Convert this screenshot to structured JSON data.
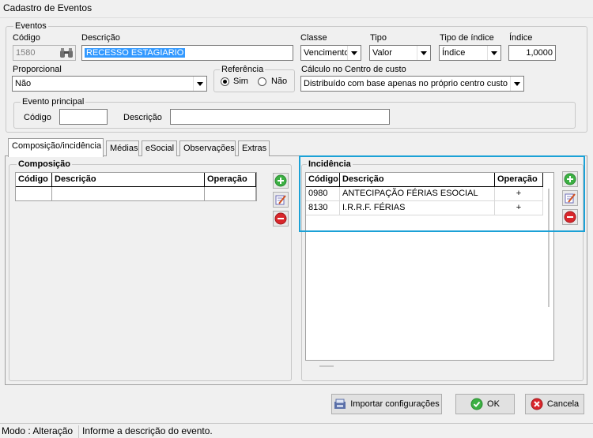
{
  "window": {
    "title": "Cadastro de Eventos"
  },
  "eventos": {
    "legend": "Eventos",
    "codigo": {
      "label": "Código",
      "value": "1580"
    },
    "descricao": {
      "label": "Descrição",
      "value": "RECESSO ESTAGIARIO"
    },
    "classe": {
      "label": "Classe",
      "value": "Vencimento"
    },
    "tipo": {
      "label": "Tipo",
      "value": "Valor"
    },
    "tipo_indice": {
      "label": "Tipo de índice",
      "value": "Índice"
    },
    "indice": {
      "label": "Índice",
      "value": "1,0000"
    },
    "proporcional": {
      "label": "Proporcional",
      "value": "Não"
    },
    "referencia": {
      "label": "Referência",
      "options": [
        "Sim",
        "Não"
      ],
      "selected": "Sim"
    },
    "calculo": {
      "label": "Cálculo no Centro de custo",
      "value": "Distribuído com base apenas no próprio centro custo"
    },
    "evento_principal": {
      "legend": "Evento principal",
      "codigo_label": "Código",
      "codigo_value": "",
      "descricao_label": "Descrição",
      "descricao_value": ""
    }
  },
  "tabs": [
    "Composição/incidência",
    "Médias",
    "eSocial",
    "Observações",
    "Extras"
  ],
  "composicao": {
    "legend": "Composição",
    "columns": [
      "Código",
      "Descrição",
      "Operação"
    ],
    "rows": []
  },
  "incidencia": {
    "legend": "Incidência",
    "columns": [
      "Código",
      "Descrição",
      "Operação"
    ],
    "rows": [
      {
        "codigo": "0980",
        "descricao": "ANTECIPAÇÃO FÉRIAS ESOCIAL",
        "operacao": "+"
      },
      {
        "codigo": "8130",
        "descricao": "I.R.R.F. FÉRIAS",
        "operacao": "+"
      }
    ]
  },
  "buttons": {
    "importar": "Importar configurações",
    "ok": "OK",
    "cancelar": "Cancela"
  },
  "status": {
    "mode": "Modo : Alteração",
    "hint": "Informe a descrição do evento."
  },
  "colors": {
    "highlight": "#1ba1d6",
    "selection": "#3399ff",
    "add": "#3cb043",
    "remove": "#d9262b"
  },
  "icons": [
    "binoculars-icon",
    "add-icon",
    "edit-icon",
    "remove-icon",
    "import-icon",
    "ok-check-icon",
    "cancel-x-icon"
  ]
}
